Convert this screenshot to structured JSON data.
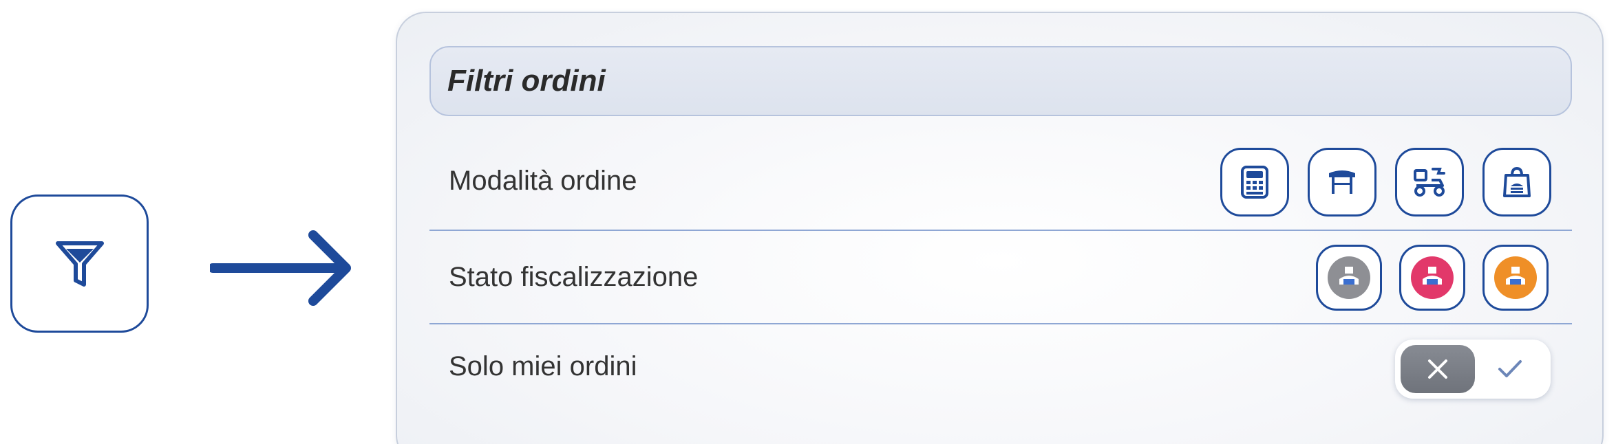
{
  "panel": {
    "title": "Filtri ordini",
    "rows": [
      {
        "label": "Modalità ordine"
      },
      {
        "label": "Stato fiscalizzazione"
      },
      {
        "label": "Solo miei ordini"
      }
    ],
    "order_modes": [
      {
        "icon": "cash-register-icon"
      },
      {
        "icon": "table-icon"
      },
      {
        "icon": "scooter-delivery-icon"
      },
      {
        "icon": "takeaway-bag-icon"
      }
    ],
    "fiscal_states": [
      {
        "icon": "receipt-printer-icon",
        "color": "#8e8f94"
      },
      {
        "icon": "receipt-printer-icon",
        "color": "#e2386a"
      },
      {
        "icon": "receipt-printer-icon",
        "color": "#ef8f27"
      }
    ],
    "my_orders_toggle": {
      "state": "off",
      "off_icon": "close-icon",
      "on_icon": "check-icon"
    }
  },
  "colors": {
    "accent": "#1e4a9a",
    "divider": "#8fa7d4"
  }
}
